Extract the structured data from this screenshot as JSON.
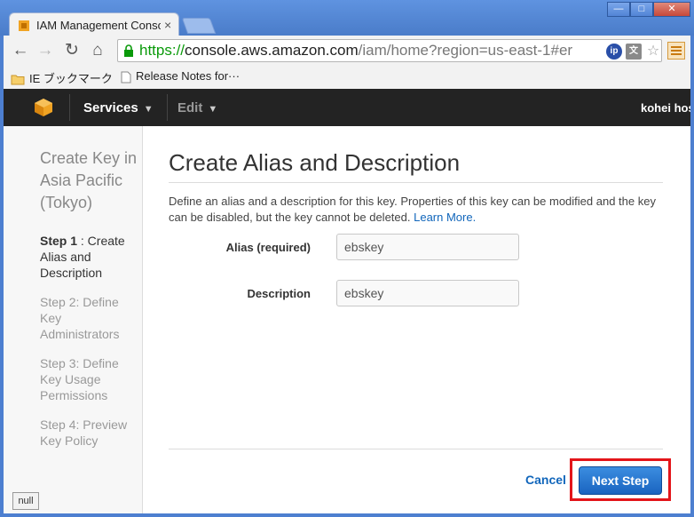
{
  "browser": {
    "tab_title": "IAM Management Console",
    "url_scheme": "https://",
    "url_host": "console.aws.amazon.com",
    "url_path": "/iam/home?region=us-east-1#er",
    "window_buttons": {
      "minimize": "—",
      "maximize": "□",
      "close": "✕"
    },
    "tab_close": "×",
    "ext_ip_label": "ip",
    "ext_translate_label": "文"
  },
  "bookmarks": {
    "items": [
      {
        "label": "IE ブックマーク",
        "icon": "folder-icon"
      },
      {
        "label": "Release Notes for···",
        "icon": "page-icon"
      }
    ]
  },
  "aws_nav": {
    "services_label": "Services",
    "edit_label": "Edit",
    "user_label": "kohei hos"
  },
  "sidebar": {
    "title": "Create Key in Asia Pacific (Tokyo)",
    "steps": [
      {
        "prefix": "Step 1",
        "label": " : Create Alias and Description",
        "active": true
      },
      {
        "label": "Step 2: Define Key Administrators",
        "active": false
      },
      {
        "label": "Step 3: Define Key Usage Permissions",
        "active": false
      },
      {
        "label": "Step 4: Preview Key Policy",
        "active": false
      }
    ]
  },
  "main": {
    "title": "Create Alias and Description",
    "description": "Define an alias and a description for this key. Properties of this key can be modified and the key can be disabled, but the key cannot be deleted.",
    "learn_more": "Learn More.",
    "alias_label": "Alias (required)",
    "alias_value": "ebskey",
    "description_label": "Description",
    "description_value": "ebskey",
    "cancel_label": "Cancel",
    "next_label": "Next Step"
  },
  "status": {
    "null_label": "null"
  },
  "colors": {
    "accent": "#1166bb",
    "highlight": "#e3151a",
    "aws_orange": "#f0a323",
    "nav_bg": "#232323"
  }
}
